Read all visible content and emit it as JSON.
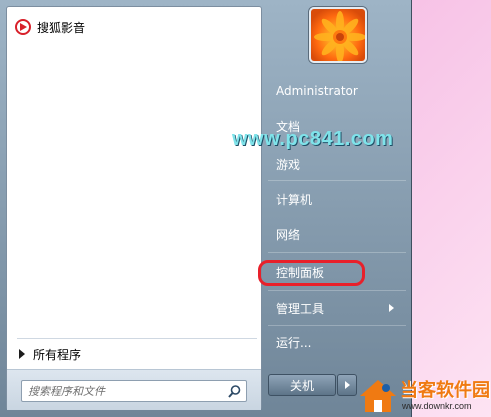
{
  "left_pane": {
    "pinned_item_label": "搜狐影音",
    "all_programs_label": "所有程序",
    "search_placeholder": "搜索程序和文件"
  },
  "right_pane": {
    "user_name": "Administrator",
    "items": [
      {
        "label": "文档"
      },
      {
        "label": "游戏"
      },
      {
        "label": "计算机"
      },
      {
        "label": "网络"
      },
      {
        "label": "控制面板"
      },
      {
        "label": "管理工具"
      },
      {
        "label": "运行..."
      }
    ],
    "shutdown_label": "关机"
  },
  "watermark": {
    "url_text": "www.pc841.com",
    "logo_text": "当客软件园",
    "logo_url": "www.downkr.com"
  },
  "colors": {
    "highlight_ring": "#e8202a",
    "watermark_url": "#7fe3ea",
    "logo_text": "#f07a12"
  },
  "icons": {
    "pinned_item": "sohu-video-icon",
    "search": "search-icon",
    "all_programs": "triangle-right-icon"
  }
}
